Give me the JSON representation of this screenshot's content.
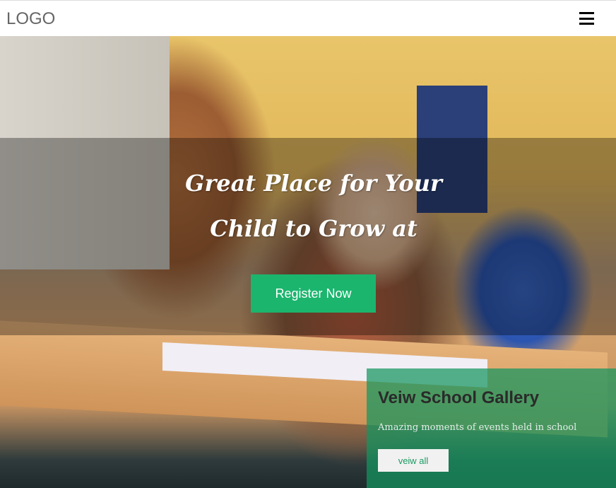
{
  "nav": {
    "logo": "LOGO",
    "menu_icon": "hamburger-icon"
  },
  "hero": {
    "headline_line1": "Great Place for Your",
    "headline_line2": "Child to Grow at",
    "register_label": "Register Now"
  },
  "gallery": {
    "title": "Veiw School Gallery",
    "subtitle": "Amazing moments of events held in school",
    "button_label": "veiw all"
  },
  "colors": {
    "accent": "#1bb56e",
    "gallery_bg": "#14965f"
  }
}
